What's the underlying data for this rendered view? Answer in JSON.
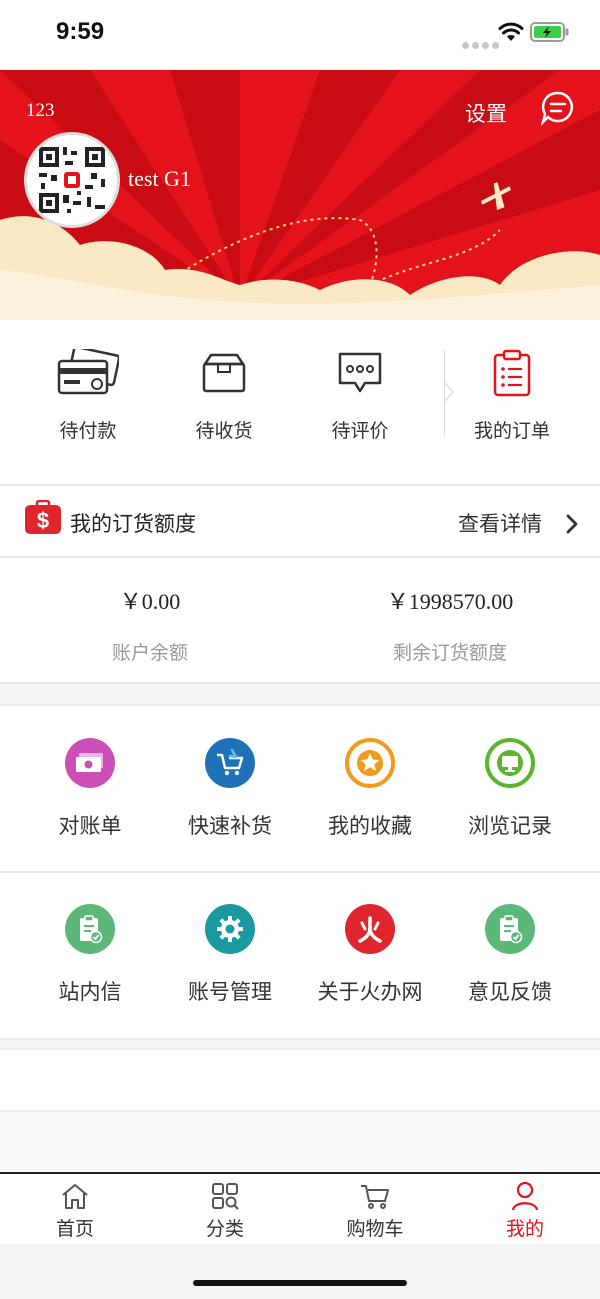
{
  "status_bar": {
    "time": "9:59"
  },
  "header": {
    "user_number": "123",
    "settings_label": "设置",
    "username": "test G1"
  },
  "orders": [
    {
      "label": "待付款",
      "icon": "credit-card-icon"
    },
    {
      "label": "待收货",
      "icon": "package-box-icon"
    },
    {
      "label": "待评价",
      "icon": "comment-bubble-icon"
    },
    {
      "label": "我的订单",
      "icon": "clipboard-list-icon"
    }
  ],
  "quota": {
    "title": "我的订货额度",
    "detail_link": "查看详情",
    "balance_value": "￥0.00",
    "balance_label": "账户余额",
    "remaining_value": "￥1998570.00",
    "remaining_label": "剩余订货额度"
  },
  "menu": [
    {
      "label": "对账单",
      "icon": "cash-bill-icon",
      "color": "#cc4fb8"
    },
    {
      "label": "快速补货",
      "icon": "cart-arrow-icon",
      "color": "#1f72b8"
    },
    {
      "label": "我的收藏",
      "icon": "star-icon",
      "color": "#f29a1b"
    },
    {
      "label": "浏览记录",
      "icon": "monitor-icon",
      "color": "#5ab42e"
    },
    {
      "label": "站内信",
      "icon": "clipboard-check-icon",
      "color": "#5bb87a"
    },
    {
      "label": "账号管理",
      "icon": "gear-icon",
      "color": "#1a9aa0"
    },
    {
      "label": "关于火办网",
      "icon": "fire-logo-icon",
      "color": "#e0262d"
    },
    {
      "label": "意见反馈",
      "icon": "clipboard-check-icon",
      "color": "#5bb87a"
    }
  ],
  "tabbar": [
    {
      "label": "首页",
      "icon": "home-icon"
    },
    {
      "label": "分类",
      "icon": "category-grid-icon"
    },
    {
      "label": "购物车",
      "icon": "shopping-cart-icon"
    },
    {
      "label": "我的",
      "icon": "person-icon",
      "active": true
    }
  ],
  "colors": {
    "brand_red": "#e3121b",
    "cloud": "#f8e8c4"
  }
}
